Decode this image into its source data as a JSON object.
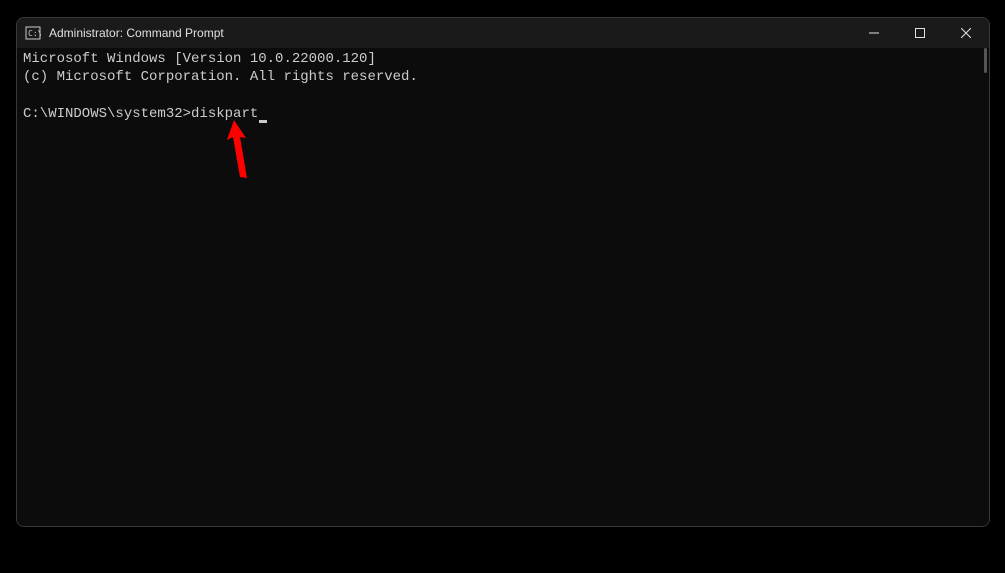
{
  "window": {
    "title": "Administrator: Command Prompt"
  },
  "terminal": {
    "line1": "Microsoft Windows [Version 10.0.22000.120]",
    "line2": "(c) Microsoft Corporation. All rights reserved.",
    "blank": "",
    "prompt": "C:\\WINDOWS\\system32>",
    "command": "diskpart"
  }
}
